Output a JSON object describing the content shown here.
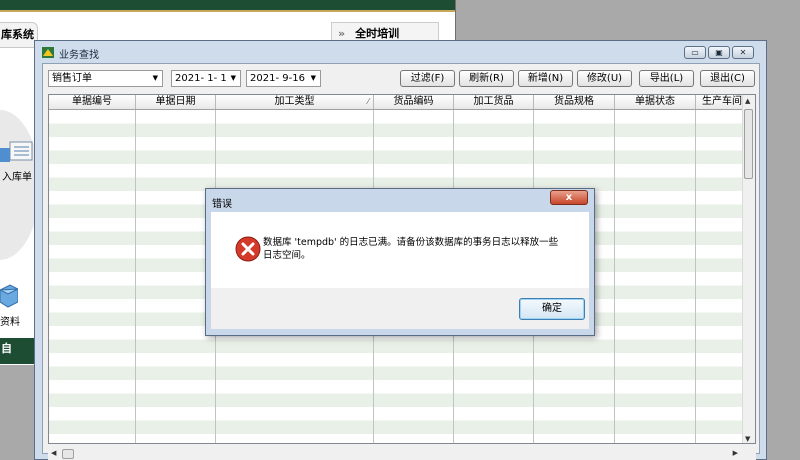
{
  "background_app": {
    "tab_label": "库系统",
    "training_label": "全时培训",
    "training_chevron": "»",
    "receipt_label": "入库单",
    "data_label": "资料",
    "bottom_label": "自"
  },
  "window": {
    "title": "业务查找",
    "caption_buttons": [
      "minimize",
      "maximize",
      "close"
    ],
    "filters": {
      "doc_type": "销售订单",
      "date_from": "2021- 1- 1",
      "date_to": "2021- 9-16"
    },
    "toolbar": {
      "filter": "过滤(F)",
      "refresh": "刷新(R)",
      "new": "新增(N)",
      "edit": "修改(U)",
      "export": "导出(L)",
      "exit": "退出(C)"
    },
    "columns": [
      "单据编号",
      "单据日期",
      "加工类型",
      "货品编码",
      "加工货品",
      "货品规格",
      "单据状态",
      "生产车间"
    ],
    "rows": []
  },
  "dialog": {
    "title": "错误",
    "close_glyph": "x",
    "message_line1": "数据库 'tempdb' 的日志已满。请备份该数据库的事务日志以释放一些",
    "message_line2": "日志空间。",
    "ok_label": "确定"
  },
  "colors": {
    "app_bar": "#1d4d33",
    "error_red": "#d43a2a",
    "row_alt": "#e8f0e7",
    "window_frame": "#cfdcec"
  }
}
